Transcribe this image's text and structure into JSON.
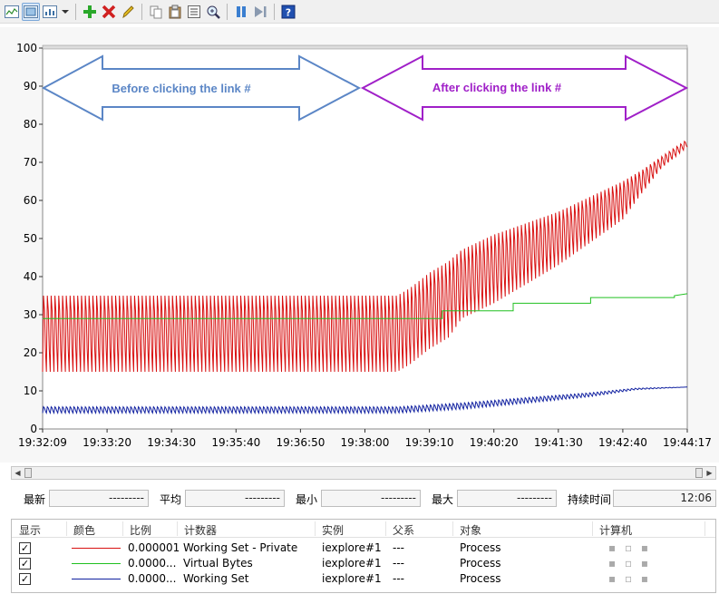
{
  "toolbar": {
    "buttons": [
      {
        "name": "view-graph-icon"
      },
      {
        "name": "view-histogram-icon"
      },
      {
        "name": "view-report-icon"
      },
      {
        "name": "add-counter-icon"
      },
      {
        "name": "delete-counter-icon"
      },
      {
        "name": "highlight-icon"
      },
      {
        "name": "copy-properties-icon"
      },
      {
        "name": "paste-counter-list-icon"
      },
      {
        "name": "properties-icon"
      },
      {
        "name": "zoom-icon"
      },
      {
        "name": "freeze-display-icon"
      },
      {
        "name": "update-data-icon"
      },
      {
        "name": "help-icon"
      }
    ]
  },
  "annotations": {
    "before_label": "Before clicking the link #",
    "after_label": "After clicking the link #",
    "before_color": "#5b86c6",
    "after_color": "#a020c8"
  },
  "chart_data": {
    "type": "line",
    "ylim": [
      0,
      100
    ],
    "yticks": [
      "100",
      "90",
      "80",
      "70",
      "60",
      "50",
      "40",
      "30",
      "20",
      "10",
      "0"
    ],
    "xticks": [
      "19:32:09",
      "19:33:20",
      "19:34:30",
      "19:35:40",
      "19:36:50",
      "19:38:00",
      "19:39:10",
      "19:40:20",
      "19:41:30",
      "19:42:40",
      "19:44:17"
    ],
    "series": [
      {
        "name": "Working Set - Private",
        "color": "#d81010",
        "x": [
          0,
          55,
          57,
          60,
          63,
          65,
          70,
          75,
          80,
          85,
          90,
          93,
          96,
          100
        ],
        "y": [
          25,
          25,
          27,
          31,
          34,
          38,
          42,
          46,
          50,
          55,
          60,
          65,
          70,
          75
        ],
        "amplitude": [
          10,
          10,
          10,
          10,
          10,
          9,
          9,
          8,
          7,
          6,
          5,
          3,
          1.5,
          1
        ]
      },
      {
        "name": "Virtual Bytes",
        "color": "#20c020",
        "x": [
          0,
          62,
          62,
          73,
          73,
          85,
          85,
          98,
          98,
          100
        ],
        "y": [
          29,
          29,
          31,
          31,
          33,
          33,
          34.5,
          34.5,
          35,
          35.5
        ]
      },
      {
        "name": "Working Set",
        "color": "#1020a0",
        "x": [
          0,
          55,
          65,
          75,
          85,
          92,
          100
        ],
        "y": [
          5,
          5,
          6,
          7.5,
          9,
          10.5,
          11
        ],
        "amplitude": [
          0.8,
          0.8,
          0.8,
          0.7,
          0.5,
          0.2,
          0
        ]
      }
    ]
  },
  "stats": {
    "latest_label": "最新",
    "latest_value": "---------",
    "average_label": "平均",
    "average_value": "---------",
    "min_label": "最小",
    "min_value": "---------",
    "max_label": "最大",
    "max_value": "---------",
    "duration_label": "持续时间",
    "duration_value": "12:06"
  },
  "counter_list": {
    "headers": [
      "显示",
      "颜色",
      "比例",
      "计数器",
      "实例",
      "父系",
      "对象",
      "计算机"
    ],
    "rows": [
      {
        "checked": "✓",
        "color": "#d81010",
        "scale": "0.000001",
        "counter": "Working Set - Private",
        "instance": "iexplore#1",
        "parent": "---",
        "object": "Process",
        "computer": "▪ ▫ ▪"
      },
      {
        "checked": "✓",
        "color": "#20c020",
        "scale": "0.0000...",
        "counter": "Virtual Bytes",
        "instance": "iexplore#1",
        "parent": "---",
        "object": "Process",
        "computer": "▪ ▫ ▪"
      },
      {
        "checked": "✓",
        "color": "#1020a0",
        "scale": "0.0000...",
        "counter": "Working Set",
        "instance": "iexplore#1",
        "parent": "---",
        "object": "Process",
        "computer": "▪ ▫ ▪"
      }
    ]
  }
}
